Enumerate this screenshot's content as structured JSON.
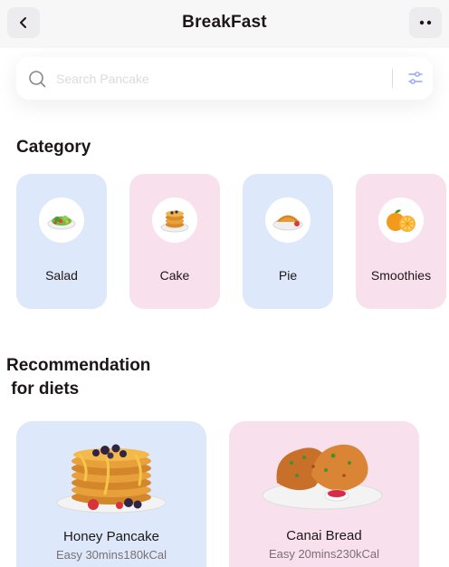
{
  "header": {
    "title": "BreakFast",
    "back_icon": "chevron-left-icon",
    "more_icon": "more-dots-icon"
  },
  "search": {
    "placeholder": "Search Pancake",
    "value": "",
    "icon": "search-icon",
    "filter_icon": "filter-icon"
  },
  "category": {
    "title": "Category",
    "items": [
      {
        "label": "Salad",
        "icon": "salad-icon",
        "color": "#dde9fb"
      },
      {
        "label": "Cake",
        "icon": "cake-icon",
        "color": "#f8e1ed"
      },
      {
        "label": "Pie",
        "icon": "pie-icon",
        "color": "#dde9fb"
      },
      {
        "label": "Smoothies",
        "icon": "orange-icon",
        "color": "#f8e1ed"
      }
    ]
  },
  "recommendation": {
    "title": "Recommendation\n for diets",
    "items": [
      {
        "name": "Honey Pancake",
        "meta": "Easy 30mins180kCal",
        "image": "pancake-stack-image",
        "color": "#dde9fb"
      },
      {
        "name": "Canai Bread",
        "meta": "Easy 20mins230kCal",
        "image": "canai-bread-image",
        "color": "#f8e1ed"
      }
    ]
  }
}
